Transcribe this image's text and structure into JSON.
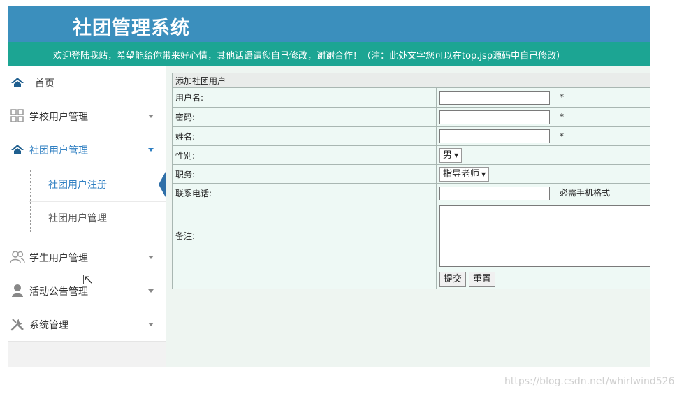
{
  "header": {
    "system_title": "社团管理系统",
    "welcome_text": "欢迎登陆我站，希望能给你带来好心情，其他话语请您自己修改，谢谢合作！（注：此处文字您可以在top.jsp源码中自己修改）"
  },
  "sidebar": {
    "items": [
      {
        "label": "首页",
        "icon": "home-icon"
      },
      {
        "label": "学校用户管理",
        "icon": "grid-icon"
      },
      {
        "label": "社团用户管理",
        "icon": "home-icon"
      },
      {
        "label": "学生用户管理",
        "icon": "users-icon"
      },
      {
        "label": "活动公告管理",
        "icon": "user-icon"
      },
      {
        "label": "系统管理",
        "icon": "tools-icon"
      }
    ],
    "submenu": [
      {
        "label": "社团用户注册"
      },
      {
        "label": "社团用户管理"
      }
    ]
  },
  "form": {
    "title": "添加社团用户",
    "rows": {
      "username": {
        "label": "用户名:",
        "value": "",
        "mark": "*"
      },
      "password": {
        "label": "密码:",
        "value": "",
        "mark": "*"
      },
      "name": {
        "label": "姓名:",
        "value": "",
        "mark": "*"
      },
      "gender": {
        "label": "性别:",
        "selected": "男"
      },
      "position": {
        "label": "职务:",
        "selected": "指导老师"
      },
      "phone": {
        "label": "联系电话:",
        "value": "",
        "hint": "必需手机格式"
      },
      "remark": {
        "label": "备注:",
        "value": ""
      }
    },
    "submit_label": "提交",
    "reset_label": "重置"
  },
  "watermark": "https://blog.csdn.net/whirlwind526",
  "colors": {
    "header_bg": "#3b8fbd",
    "welcome_bg": "#1ca593",
    "active": "#2f7fc2"
  }
}
